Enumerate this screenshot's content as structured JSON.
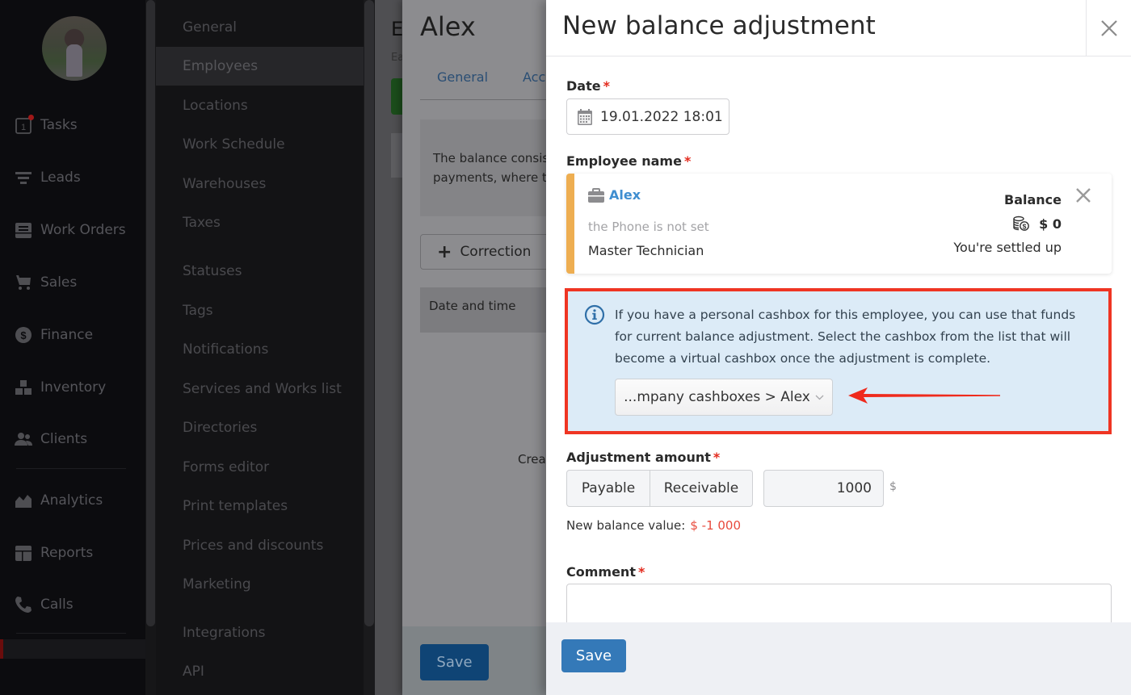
{
  "main_nav": {
    "items": [
      {
        "label": "Tasks",
        "icon": "tasks-calendar-icon",
        "badge_count": "1"
      },
      {
        "label": "Leads",
        "icon": "funnel-icon"
      },
      {
        "label": "Work Orders",
        "icon": "work-order-icon"
      },
      {
        "label": "Sales",
        "icon": "cart-icon"
      },
      {
        "label": "Finance",
        "icon": "dollar-circle-icon"
      },
      {
        "label": "Inventory",
        "icon": "boxes-icon"
      },
      {
        "label": "Clients",
        "icon": "users-icon"
      },
      {
        "label": "Analytics",
        "icon": "chart-area-icon"
      },
      {
        "label": "Reports",
        "icon": "table-icon"
      },
      {
        "label": "Calls",
        "icon": "phone-icon"
      }
    ]
  },
  "settings_nav": {
    "items": [
      {
        "label": "General"
      },
      {
        "label": "Employees",
        "active": true
      },
      {
        "label": "Locations"
      },
      {
        "label": "Work Schedule"
      },
      {
        "label": "Warehouses"
      },
      {
        "label": "Taxes"
      },
      {
        "label": "Statuses"
      },
      {
        "label": "Tags"
      },
      {
        "label": "Notifications"
      },
      {
        "label": "Services and Works list"
      },
      {
        "label": "Directories"
      },
      {
        "label": "Forms editor"
      },
      {
        "label": "Print templates"
      },
      {
        "label": "Prices and discounts"
      },
      {
        "label": "Marketing"
      },
      {
        "label": "Integrations"
      },
      {
        "label": "API"
      }
    ]
  },
  "page_behind": {
    "title_fragment": "E",
    "subtitle_fragment": "Ea"
  },
  "employee_panel": {
    "title": "Alex",
    "tabs": [
      {
        "label": "General"
      },
      {
        "label": "Acc"
      }
    ],
    "info_text_line1": "The balance consis",
    "info_text_line2": "payments, where t",
    "correction_label": "Correction",
    "table_header": "Date and time",
    "empty_text_fragment": "Crea",
    "save_label": "Save"
  },
  "modal": {
    "title": "New balance adjustment",
    "date": {
      "label": "Date",
      "value": "19.01.2022 18:01"
    },
    "employee": {
      "label": "Employee name",
      "name": "Alex",
      "phone": "the Phone is not set",
      "role": "Master Technician",
      "balance_label": "Balance",
      "balance_value": "$ 0",
      "balance_status": "You're settled up"
    },
    "cashbox_notice": {
      "text": "If you have a personal cashbox for this employee, you can use that funds for current balance adjustment. Select the cashbox from the list that will become a virtual cashbox once the adjustment is complete.",
      "selected_cashbox": "...mpany cashboxes > Alex"
    },
    "adjustment": {
      "label": "Adjustment amount",
      "payable_label": "Payable",
      "receivable_label": "Receivable",
      "amount": "1000",
      "currency": "$",
      "new_balance_label": "New balance value:",
      "new_balance_value": "$ -1 000"
    },
    "comment": {
      "label": "Comment",
      "value": ""
    },
    "save_label": "Save",
    "required_mark": "*"
  },
  "colors": {
    "accent_blue": "#3479b8",
    "link_blue": "#3f8ed0",
    "required_red": "#e32b1e",
    "highlight_red": "#ef3523",
    "notice_bg": "#dcebf7",
    "card_accent": "#eeae51",
    "negative_value": "#e84a3c"
  }
}
